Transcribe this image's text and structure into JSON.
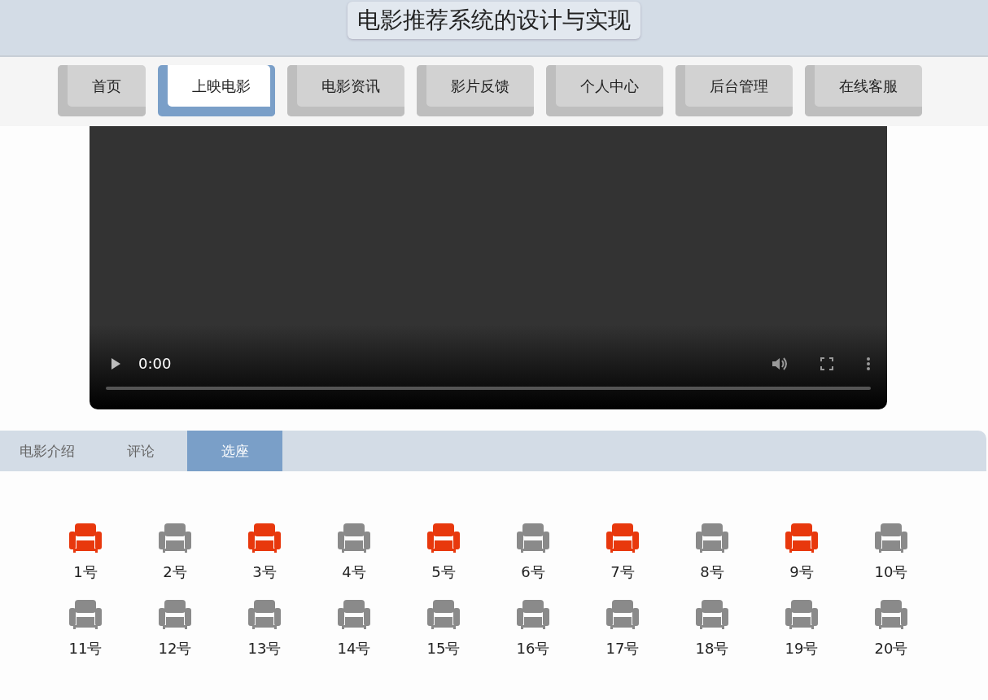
{
  "header": {
    "title": "电影推荐系统的设计与实现"
  },
  "nav": [
    {
      "label": "首页",
      "selected": false
    },
    {
      "label": "上映电影",
      "selected": true
    },
    {
      "label": "电影资讯",
      "selected": false
    },
    {
      "label": "影片反馈",
      "selected": false
    },
    {
      "label": "个人中心",
      "selected": false
    },
    {
      "label": "后台管理",
      "selected": false
    },
    {
      "label": "在线客服",
      "selected": false
    }
  ],
  "video": {
    "time": "0:00"
  },
  "tabs": [
    {
      "label": "电影介绍",
      "selected": false
    },
    {
      "label": "评论",
      "selected": false
    },
    {
      "label": "选座",
      "selected": true
    }
  ],
  "seats": [
    {
      "label": "1号",
      "taken": true
    },
    {
      "label": "2号",
      "taken": false
    },
    {
      "label": "3号",
      "taken": true
    },
    {
      "label": "4号",
      "taken": false
    },
    {
      "label": "5号",
      "taken": true
    },
    {
      "label": "6号",
      "taken": false
    },
    {
      "label": "7号",
      "taken": true
    },
    {
      "label": "8号",
      "taken": false
    },
    {
      "label": "9号",
      "taken": true
    },
    {
      "label": "10号",
      "taken": false
    },
    {
      "label": "11号",
      "taken": false
    },
    {
      "label": "12号",
      "taken": false
    },
    {
      "label": "13号",
      "taken": false
    },
    {
      "label": "14号",
      "taken": false
    },
    {
      "label": "15号",
      "taken": false
    },
    {
      "label": "16号",
      "taken": false
    },
    {
      "label": "17号",
      "taken": false
    },
    {
      "label": "18号",
      "taken": false
    },
    {
      "label": "19号",
      "taken": false
    },
    {
      "label": "20号",
      "taken": false
    }
  ]
}
